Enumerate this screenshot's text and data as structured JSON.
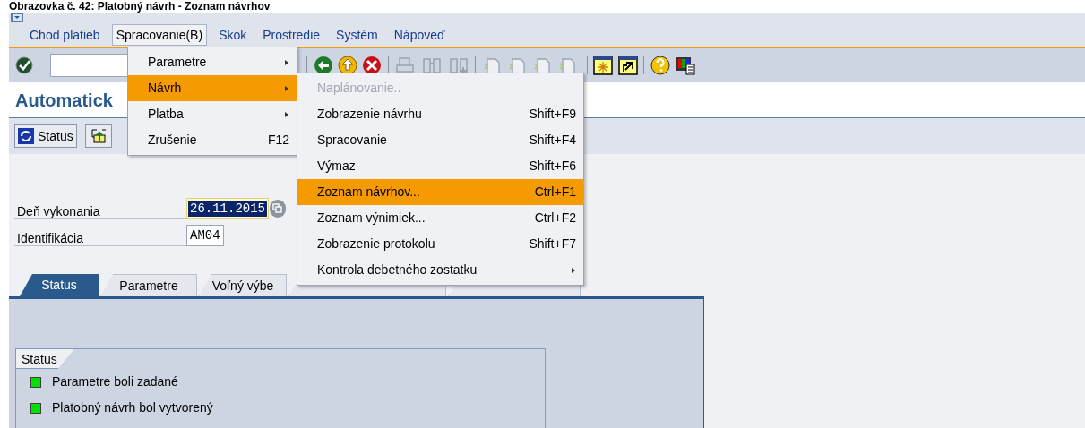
{
  "caption": "Obrazovka č. 42: Platobný návrh - Zoznam návrhov",
  "menu_bar": [
    {
      "label": "Chod platieb",
      "selected": false
    },
    {
      "label": "Spracovanie(B)",
      "selected": true
    },
    {
      "label": "Skok",
      "selected": false
    },
    {
      "label": "Prostredie",
      "selected": false
    },
    {
      "label": "Systém",
      "selected": false
    },
    {
      "label": "Nápoveď",
      "selected": false
    }
  ],
  "dropdown": [
    {
      "label": "Parametre",
      "has_submenu": true,
      "selected": false
    },
    {
      "label": "Návrh",
      "has_submenu": true,
      "selected": true
    },
    {
      "label": "Platba",
      "has_submenu": true,
      "selected": false
    },
    {
      "label": "Zrušenie",
      "shortcut": "F12",
      "has_submenu": false,
      "selected": false
    }
  ],
  "submenu": [
    {
      "label": "Naplánovanie..",
      "disabled": true,
      "has_submenu": false,
      "selected": false
    },
    {
      "label": "Zobrazenie návrhu",
      "shortcut": "Shift+F9",
      "disabled": false,
      "has_submenu": false,
      "selected": false
    },
    {
      "label": "Spracovanie",
      "shortcut": "Shift+F4",
      "disabled": false,
      "has_submenu": false,
      "selected": false
    },
    {
      "label": "Výmaz",
      "shortcut": "Shift+F6",
      "disabled": false,
      "has_submenu": false,
      "selected": false
    },
    {
      "label": "Zoznam návrhov...",
      "shortcut": "Ctrl+F1",
      "disabled": false,
      "has_submenu": false,
      "selected": true
    },
    {
      "label": "Zoznam výnimiek...",
      "shortcut": "Ctrl+F2",
      "disabled": false,
      "has_submenu": false,
      "selected": false
    },
    {
      "label": "Zobrazenie protokolu",
      "shortcut": "Shift+F7",
      "disabled": false,
      "has_submenu": false,
      "selected": false
    },
    {
      "label": "Kontrola debetného zostatku",
      "disabled": false,
      "has_submenu": true,
      "selected": false
    }
  ],
  "page_title": "Automatick",
  "app_toolbar": [
    {
      "label": "Status"
    }
  ],
  "fields": [
    {
      "label": "Deň vykonania",
      "value": "26.11.2015",
      "selected": true
    },
    {
      "label": "Identifikácia",
      "value": "AM04",
      "selected": false
    }
  ],
  "tabs": [
    {
      "label": "Status",
      "selected": true
    },
    {
      "label": "Parametre",
      "selected": false
    },
    {
      "label": "Voľný výbe",
      "selected": false
    },
    {
      "selected": false
    },
    {
      "selected": false
    }
  ],
  "status_group": {
    "title": "Status",
    "items": [
      {
        "text": "Parametre boli zadané",
        "color": "#00e000"
      },
      {
        "text": "Platobný návrh bol vytvorený",
        "color": "#00e000"
      }
    ]
  }
}
